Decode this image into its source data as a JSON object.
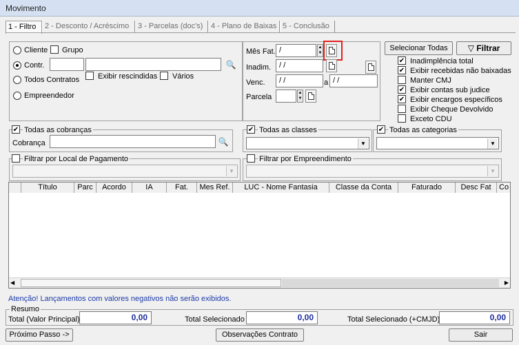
{
  "window": {
    "title": "Movimento"
  },
  "tabs": [
    {
      "label": "1 - Filtro"
    },
    {
      "label": "2 - Desconto / Acréscimo"
    },
    {
      "label": "3 - Parcelas (doc's)"
    },
    {
      "label": "4 - Plano de Baixas"
    },
    {
      "label": "5 - Conclusão"
    }
  ],
  "client_group": {
    "cliente_label": "Cliente",
    "grupo_label": "Grupo",
    "contr_label": "Contr.",
    "exibir_rescindidas_label": "Exibir rescindidas",
    "varios_label": "Vários",
    "todos_contratos_label": "Todos Contratos",
    "empreendedor_label": "Empreendedor"
  },
  "dates": {
    "mes_fat_label": "Mês Fat.",
    "mes_fat_value": " /",
    "inadim_label": "Inadim.",
    "inadim_value": " / /",
    "venc_label": "Venc.",
    "venc_from_value": " / /",
    "venc_sep": "a",
    "venc_to_value": " / /",
    "parcela_label": "Parcela"
  },
  "actions": {
    "selecionar_todas_label": "Selecionar Todas",
    "filtrar_label": "Filtrar"
  },
  "options": [
    {
      "label": "Inadimplência total",
      "checked": true
    },
    {
      "label": "Exibir recebidas não baixadas",
      "checked": true
    },
    {
      "label": "Manter CMJ",
      "checked": false
    },
    {
      "label": "Exibir contas sub judice",
      "checked": true
    },
    {
      "label": "Exibir encargos específicos",
      "checked": true
    },
    {
      "label": "Exibir Cheque Devolvido",
      "checked": false
    },
    {
      "label": "Exceto CDU",
      "checked": false
    }
  ],
  "filters": {
    "todas_cobrancas_label": "Todas as cobranças",
    "cobranca_label": "Cobrança",
    "todas_classes_label": "Todas as classes",
    "todas_categorias_label": "Todas as categorias",
    "local_pagamento_label": "Filtrar por Local de Pagamento",
    "empreendimento_label": "Filtrar por Empreendimento"
  },
  "grid": {
    "columns": [
      "Título",
      "Parc",
      "Acordo",
      "IA",
      "Fat.",
      "Mes Ref.",
      "LUC - Nome Fantasia",
      "Classe da Conta",
      "Faturado",
      "Desc Fat",
      "Co"
    ]
  },
  "warning": "Atenção! Lançamentos com valores negativos não serão exibidos.",
  "summary": {
    "title": "Resumo",
    "total_principal_label": "Total (Valor Principal)",
    "total_principal_value": "0,00",
    "total_selecionado_label": "Total Selecionado",
    "total_selecionado_value": "0,00",
    "total_selecionado_cmjd_label": "Total Selecionado (+CMJD)",
    "total_selecionado_cmjd_value": "0,00"
  },
  "footer": {
    "proximo_label": "Próximo Passo ->",
    "observacoes_label": "Observações Contrato",
    "sair_label": "Sair"
  },
  "colors": {
    "highlight": "#e0201c",
    "value_text": "#1c2d9c",
    "warning_text": "#1c3aa8"
  }
}
